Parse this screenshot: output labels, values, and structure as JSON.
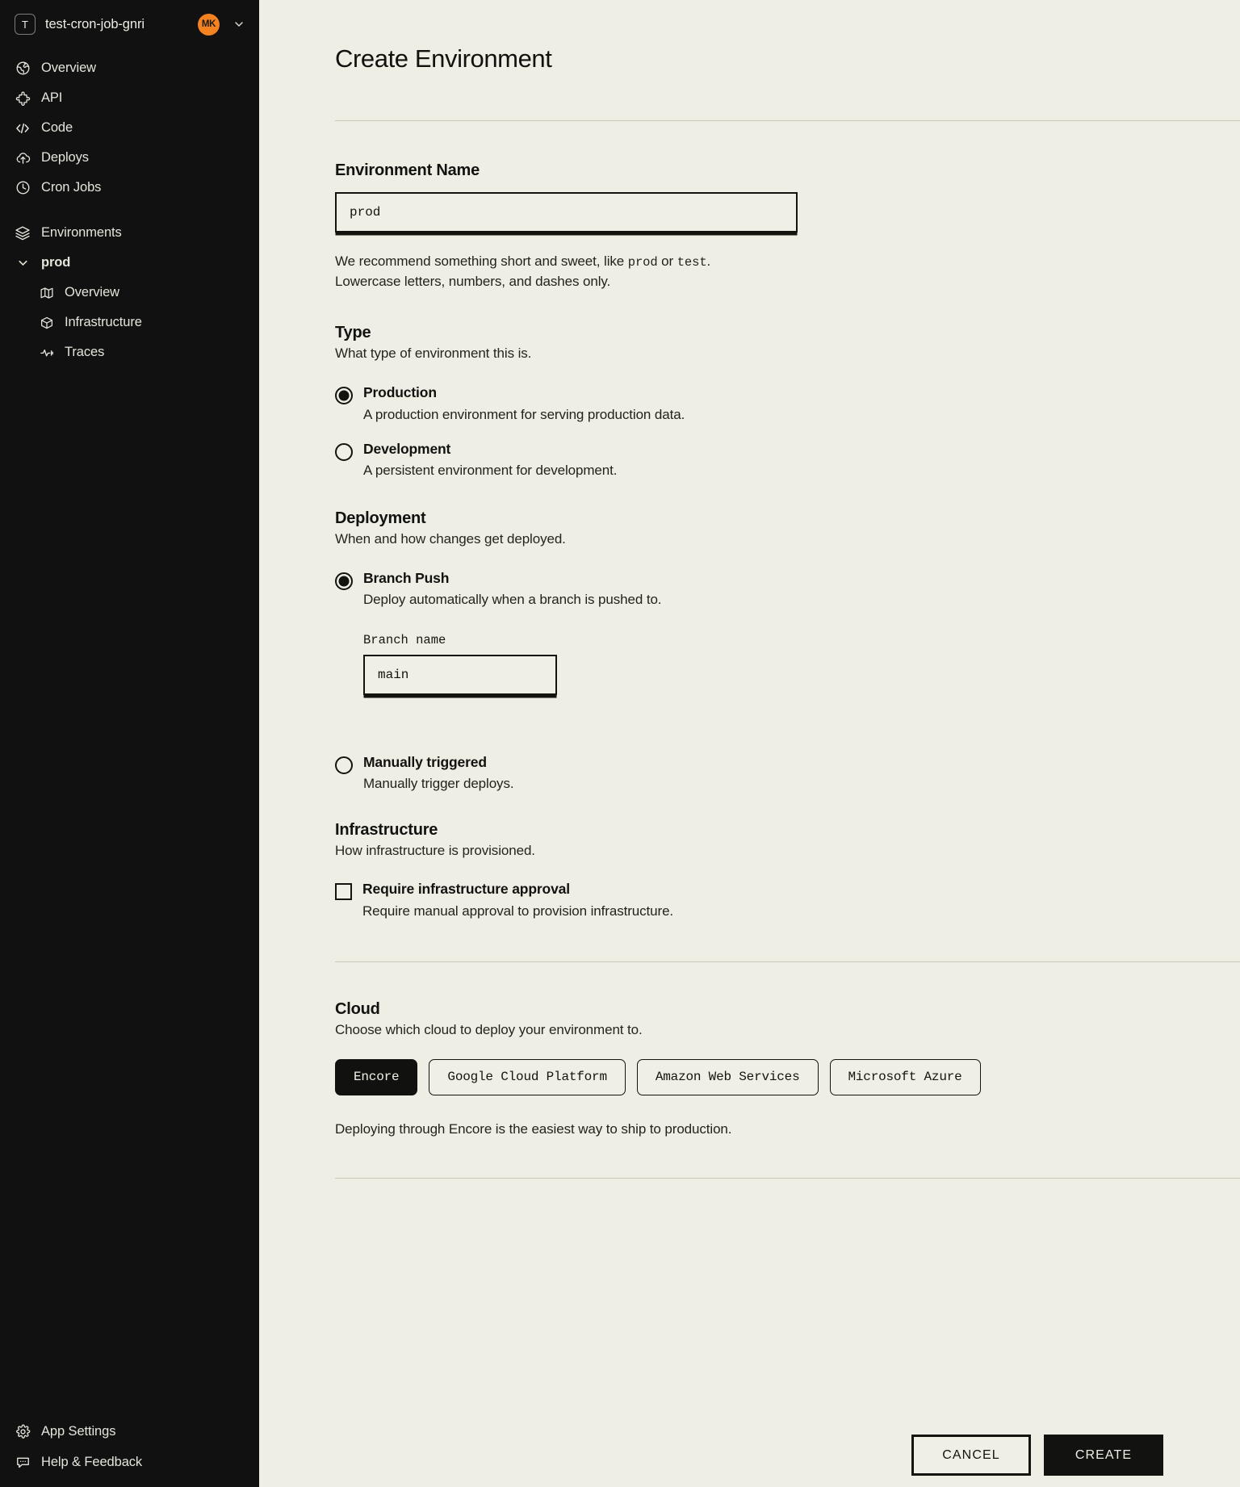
{
  "sidebar": {
    "app_badge_letter": "T",
    "app_name": "test-cron-job-gnri",
    "avatar_initials": "MK",
    "nav_primary": [
      {
        "label": "Overview",
        "icon": "globe-icon"
      },
      {
        "label": "API",
        "icon": "puzzle-icon"
      },
      {
        "label": "Code",
        "icon": "code-icon"
      },
      {
        "label": "Deploys",
        "icon": "cloud-upload-icon"
      },
      {
        "label": "Cron Jobs",
        "icon": "clock-icon"
      }
    ],
    "environments_label": "Environments",
    "env_group_label": "prod",
    "env_children": [
      {
        "label": "Overview",
        "icon": "map-icon"
      },
      {
        "label": "Infrastructure",
        "icon": "box-icon"
      },
      {
        "label": "Traces",
        "icon": "activity-icon"
      }
    ],
    "footer": [
      {
        "label": "App Settings",
        "icon": "gear-icon"
      },
      {
        "label": "Help & Feedback",
        "icon": "chat-icon"
      }
    ]
  },
  "main": {
    "page_title": "Create Environment",
    "env_name": {
      "label": "Environment Name",
      "value": "prod",
      "placeholder": "prod",
      "help_prefix": "We recommend something short and sweet, like ",
      "help_code_1": "prod",
      "help_mid": " or ",
      "help_code_2": "test",
      "help_suffix": ".",
      "help_line2": "Lowercase letters, numbers, and dashes only."
    },
    "type": {
      "heading": "Type",
      "subtitle": "What type of environment this is.",
      "options": [
        {
          "title": "Production",
          "desc": "A production environment for serving production data.",
          "selected": true
        },
        {
          "title": "Development",
          "desc": "A persistent environment for development.",
          "selected": false
        }
      ]
    },
    "deployment": {
      "heading": "Deployment",
      "subtitle": "When and how changes get deployed.",
      "options": [
        {
          "title": "Branch Push",
          "desc": "Deploy automatically when a branch is pushed to.",
          "selected": true
        },
        {
          "title": "Manually triggered",
          "desc": "Manually trigger deploys.",
          "selected": false
        }
      ],
      "branch_label": "Branch name",
      "branch_value": "main",
      "branch_placeholder": "main"
    },
    "infrastructure": {
      "heading": "Infrastructure",
      "subtitle": "How infrastructure is provisioned.",
      "checkbox_title": "Require infrastructure approval",
      "checkbox_desc": "Require manual approval to provision infrastructure.",
      "checked": false
    },
    "cloud": {
      "heading": "Cloud",
      "subtitle": "Choose which cloud to deploy your environment to.",
      "options": [
        {
          "label": "Encore",
          "selected": true
        },
        {
          "label": "Google Cloud Platform",
          "selected": false
        },
        {
          "label": "Amazon Web Services",
          "selected": false
        },
        {
          "label": "Microsoft Azure",
          "selected": false
        }
      ],
      "note": "Deploying through Encore is the easiest way to ship to production."
    },
    "actions": {
      "cancel_label": "CANCEL",
      "create_label": "CREATE"
    }
  },
  "colors": {
    "sidebar_bg": "#111111",
    "page_bg": "#eeeee4",
    "ink": "#14140f",
    "avatar": "#f58220"
  }
}
